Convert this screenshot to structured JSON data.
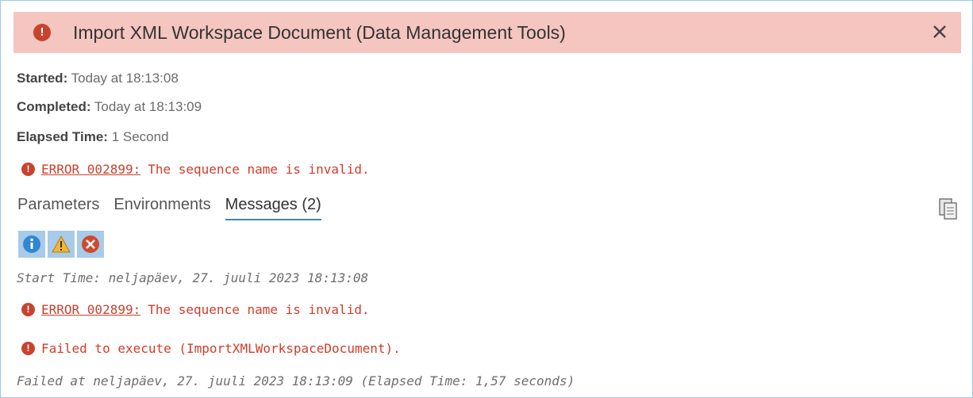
{
  "dialog": {
    "title": "Import XML Workspace Document (Data Management Tools)"
  },
  "info": {
    "started_label": "Started:",
    "started_value": "Today at 18:13:08",
    "completed_label": "Completed:",
    "completed_value": "Today at 18:13:09",
    "elapsed_label": "Elapsed Time:",
    "elapsed_value": "1 Second"
  },
  "summary_error": {
    "code": "ERROR 002899:",
    "text": "The sequence name is invalid."
  },
  "tabs": [
    {
      "label": "Parameters"
    },
    {
      "label": "Environments"
    },
    {
      "label": "Messages (2)"
    }
  ],
  "messages": {
    "start_time": "Start Time: neljapäev, 27. juuli 2023 18:13:08",
    "error_code": "ERROR 002899:",
    "error_text": "The sequence name is invalid.",
    "failed_exec": "Failed to execute (ImportXMLWorkspaceDocument).",
    "failed_at": "Failed at neljapäev, 27. juuli 2023 18:13:09 (Elapsed Time: 1,57 seconds)"
  },
  "colors": {
    "header_bg": "#f4c6bf",
    "error_red": "#d13c2a",
    "filter_bg": "#a7cbe9",
    "tab_underline": "#3b86c4"
  }
}
